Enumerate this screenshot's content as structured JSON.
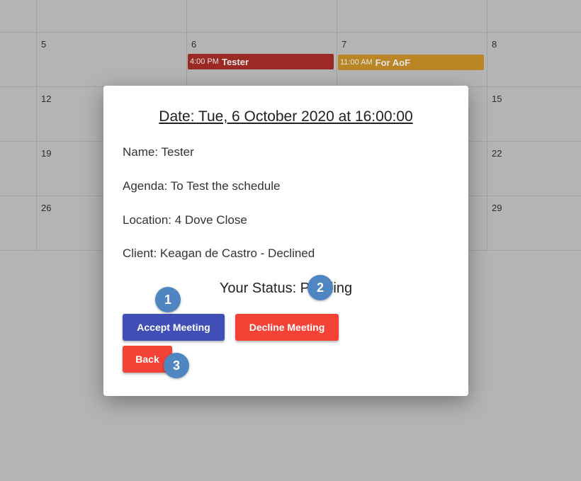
{
  "calendar": {
    "day_numbers": [
      "5",
      "6",
      "7",
      "8",
      "12",
      "15",
      "19",
      "22",
      "26",
      "29"
    ],
    "events": [
      {
        "time": "4:00 PM",
        "title": "Tester",
        "color": "#9a2a23"
      },
      {
        "time": "11:00 AM",
        "title": "For AoF",
        "color": "#b98525"
      }
    ]
  },
  "modal": {
    "date_heading": "Date: Tue, 6 October 2020 at 16:00:00",
    "name": "Name: Tester",
    "agenda": "Agenda: To Test the schedule",
    "location": "Location: 4 Dove Close",
    "client": "Client: Keagan de Castro - Declined",
    "status": "Your Status: Pending",
    "accept_label": "Accept Meeting",
    "decline_label": "Decline Meeting",
    "back_label": "Back"
  },
  "markers": [
    "1",
    "2",
    "3"
  ],
  "colors": {
    "accept": "#3f4fb6",
    "decline": "#f44336",
    "marker": "#4f86c1",
    "overlay": "#b4b4b4"
  }
}
